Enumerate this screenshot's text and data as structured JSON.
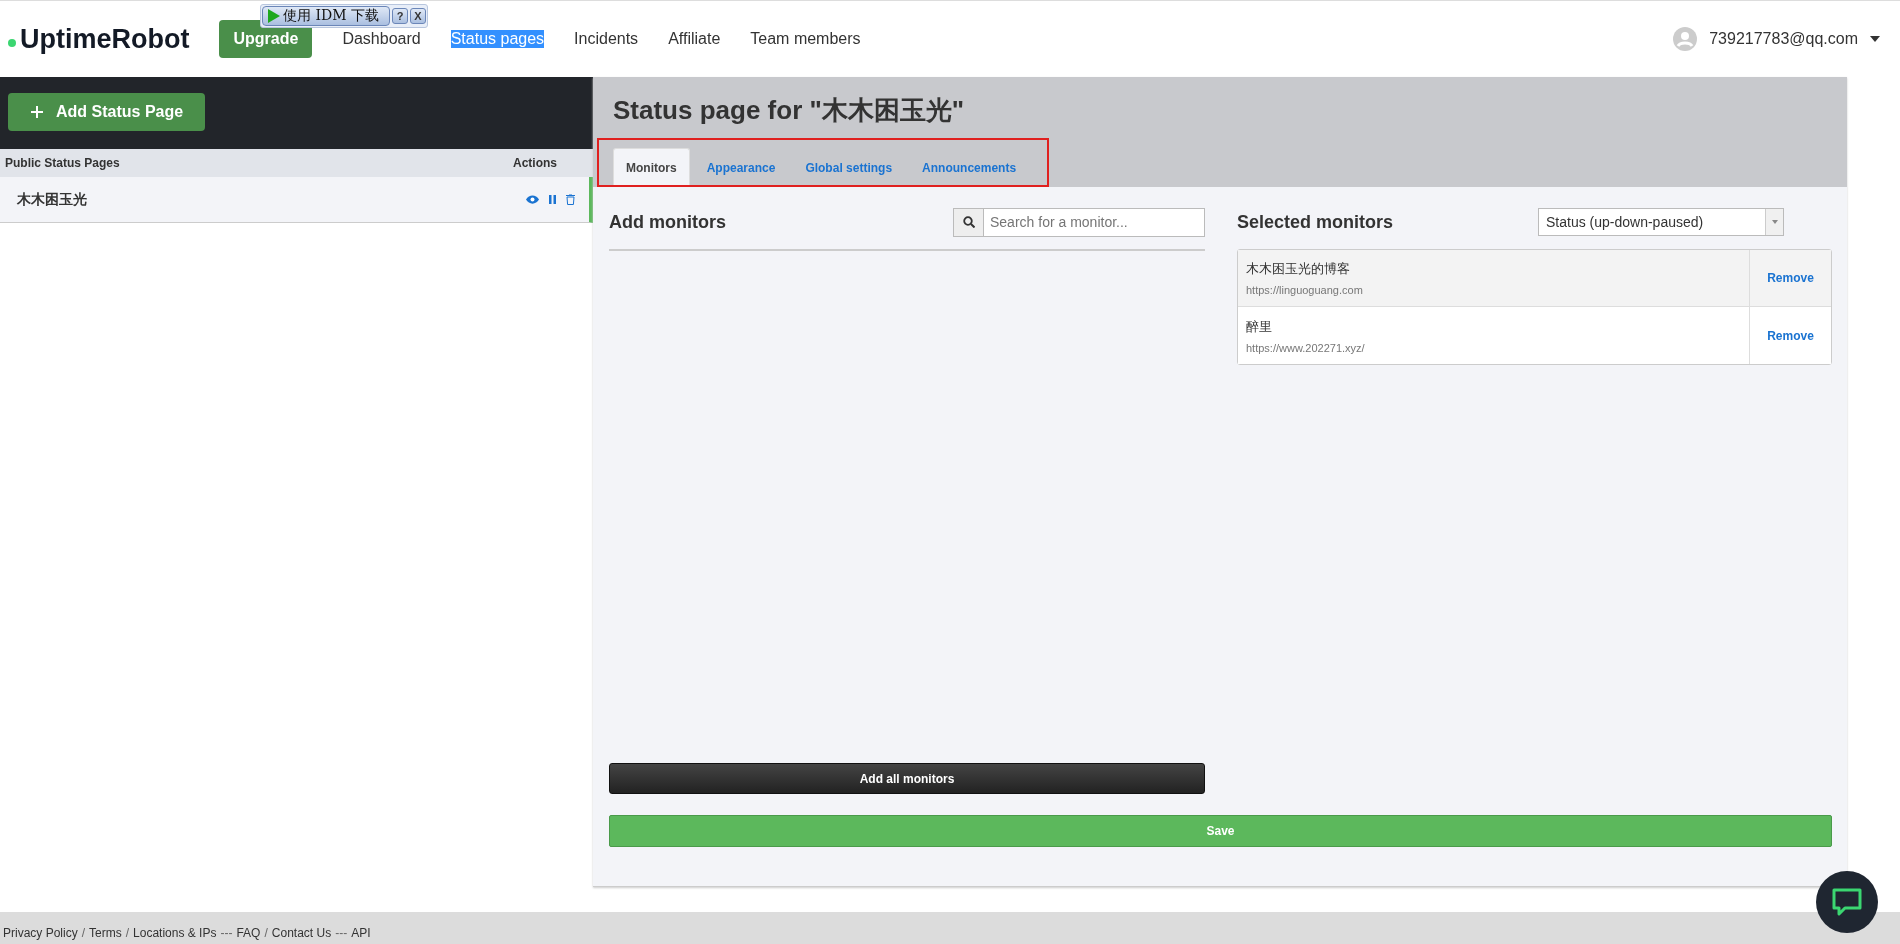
{
  "header": {
    "logo": "UptimeRobot",
    "upgrade": "Upgrade",
    "nav": [
      {
        "label": "Dashboard",
        "highlighted": false
      },
      {
        "label": "Status pages",
        "highlighted": true
      },
      {
        "label": "Incidents",
        "highlighted": false
      },
      {
        "label": "Affiliate",
        "highlighted": false
      },
      {
        "label": "Team members",
        "highlighted": false
      }
    ],
    "user": "739217783@qq.com"
  },
  "idm_bar": {
    "label": "使用 IDM 下载",
    "help": "?",
    "close": "X"
  },
  "sidebar": {
    "add_button": "Add Status Page",
    "columns": [
      "Public Status Pages",
      "Actions"
    ],
    "items": [
      {
        "name": "木木困玉光",
        "selected": true
      }
    ]
  },
  "main": {
    "title_prefix": "Status page for ",
    "title_name": "\"木木困玉光\"",
    "tabs": [
      {
        "label": "Monitors",
        "selected": true
      },
      {
        "label": "Appearance",
        "selected": false
      },
      {
        "label": "Global settings",
        "selected": false
      },
      {
        "label": "Announcements",
        "selected": false
      }
    ],
    "add_monitors": {
      "heading": "Add monitors",
      "search_placeholder": "Search for a monitor...",
      "add_all": "Add all monitors"
    },
    "selected_monitors": {
      "heading": "Selected monitors",
      "sort": "Status (up-down-paused)",
      "items": [
        {
          "name": "木木困玉光的博客",
          "url": "https://linguoguang.com",
          "action": "Remove",
          "hovered": true
        },
        {
          "name": "醉里",
          "url": "https://www.202271.xyz/",
          "action": "Remove",
          "hovered": false
        }
      ]
    },
    "save": "Save"
  },
  "footer": [
    {
      "kind": "link",
      "text": "Privacy Policy"
    },
    {
      "kind": "sep",
      "text": "/"
    },
    {
      "kind": "link",
      "text": "Terms"
    },
    {
      "kind": "sep",
      "text": "/"
    },
    {
      "kind": "link",
      "text": "Locations & IPs"
    },
    {
      "kind": "sep",
      "text": "---"
    },
    {
      "kind": "link",
      "text": "FAQ"
    },
    {
      "kind": "sep",
      "text": "/"
    },
    {
      "kind": "link",
      "text": "Contact Us"
    },
    {
      "kind": "sep",
      "text": "---"
    },
    {
      "kind": "link",
      "text": "API"
    }
  ]
}
